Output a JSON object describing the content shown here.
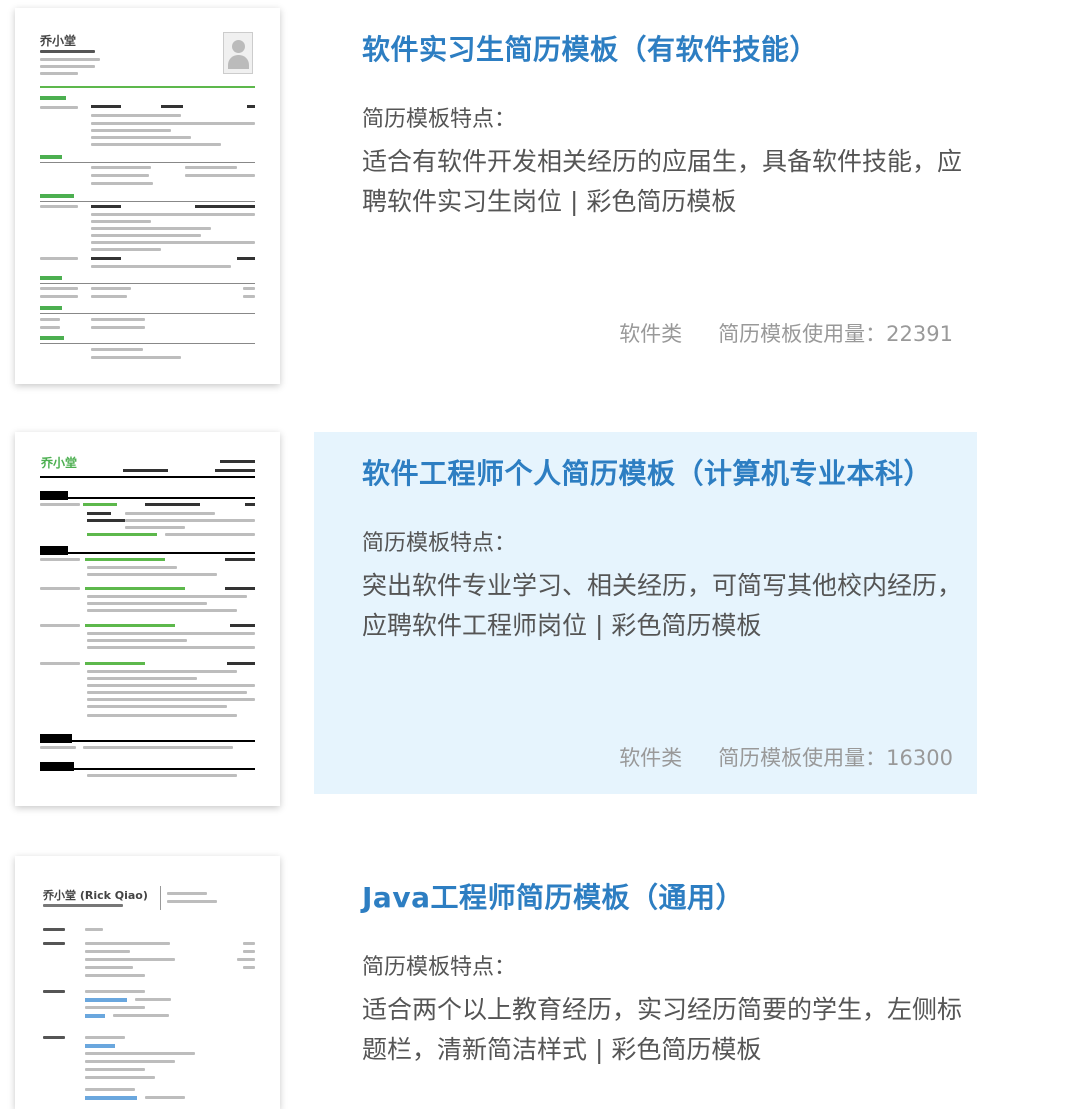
{
  "templates": [
    {
      "title": "软件实习生简历模板（有软件技能）",
      "feature_label": "简历模板特点：",
      "description": "适合有软件开发相关经历的应届生，具备软件技能，应聘软件实习生岗位 | 彩色简历模板",
      "category": "软件类",
      "usage": "简历模板使用量：22391",
      "thumb_name": "乔小堂"
    },
    {
      "title": "软件工程师个人简历模板（计算机专业本科）",
      "feature_label": "简历模板特点：",
      "description": "突出软件专业学习、相关经历，可简写其他校内经历，应聘软件工程师岗位 | 彩色简历模板",
      "category": "软件类",
      "usage": "简历模板使用量：16300",
      "thumb_name": "乔小堂"
    },
    {
      "title": "Java工程师简历模板（通用）",
      "feature_label": "简历模板特点：",
      "description": "适合两个以上教育经历，实习经历简要的学生，左侧标题栏，清新简洁样式 | 彩色简历模板",
      "category": "",
      "usage": "",
      "thumb_name": "乔小堂 (Rick Qiao)"
    }
  ],
  "colors": {
    "title": "#2d7ec2",
    "highlight_bg": "#e6f4fd",
    "accent_green": "#4caf50"
  }
}
